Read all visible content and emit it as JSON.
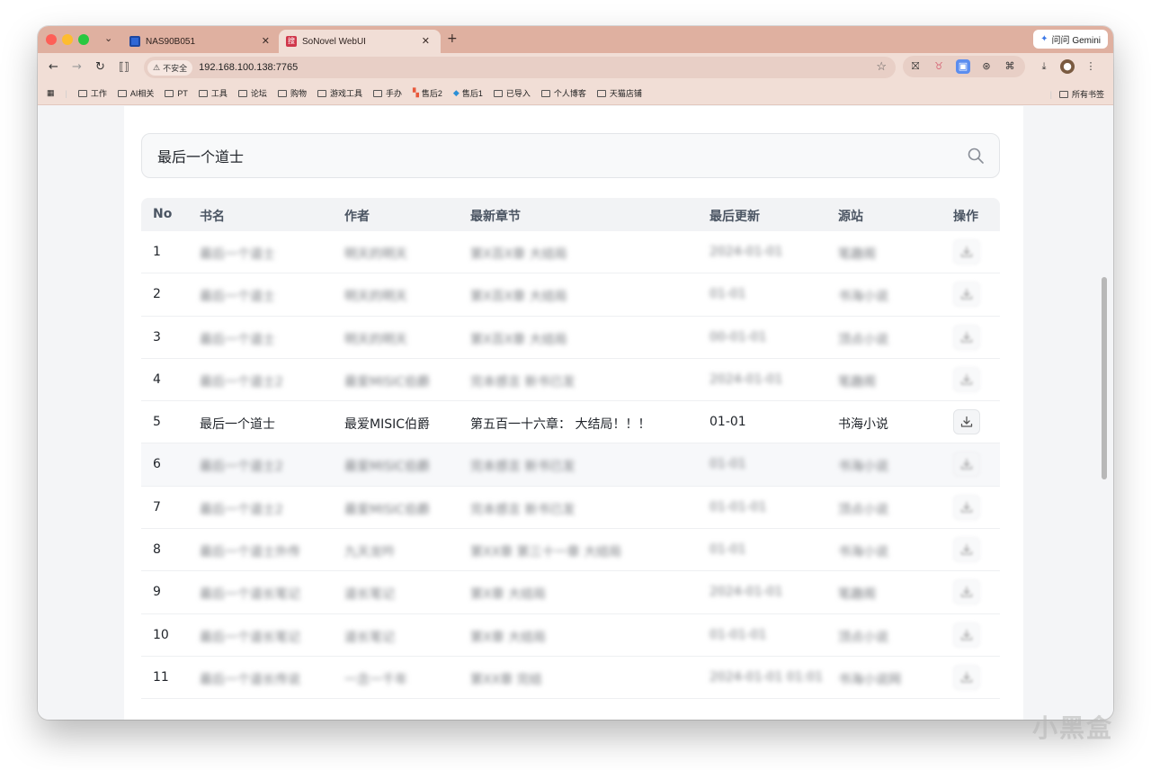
{
  "browser": {
    "tabs": [
      {
        "title": "NAS90B051"
      },
      {
        "title": "SoNovel WebUI"
      }
    ],
    "gemini_label": "问问 Gemini",
    "insecure_label": "不安全",
    "url": "192.168.100.138:7765",
    "bookmarks": [
      "工作",
      "AI相关",
      "PT",
      "工具",
      "论坛",
      "购物",
      "游戏工具",
      "手办",
      "售后2",
      "售后1",
      "已导入",
      "个人博客",
      "天猫店铺"
    ],
    "all_bookmarks": "所有书签",
    "colors": {
      "tabstrip": "#dfb0a0",
      "toolbar": "#f1ded6"
    }
  },
  "search": {
    "query": "最后一个道士"
  },
  "table": {
    "headers": [
      "No",
      "书名",
      "作者",
      "最新章节",
      "最后更新",
      "源站",
      "操作"
    ],
    "rows": [
      {
        "no": "1",
        "name": "最后一个道士",
        "author": "明天的明天",
        "chapter": "第X百X章 大结局",
        "update": "2024-01-01",
        "source": "笔趣阁",
        "visible": false
      },
      {
        "no": "2",
        "name": "最后一个道士",
        "author": "明天的明天",
        "chapter": "第X百X章 大结局",
        "update": "01-01",
        "source": "书海小说",
        "visible": false
      },
      {
        "no": "3",
        "name": "最后一个道士",
        "author": "明天的明天",
        "chapter": "第X百X章 大结局",
        "update": "00-01-01",
        "source": "顶点小说",
        "visible": false
      },
      {
        "no": "4",
        "name": "最后一个道士2",
        "author": "最爱MISIC伯爵",
        "chapter": "完本感言 新书已发",
        "update": "2024-01-01",
        "source": "笔趣阁",
        "visible": false
      },
      {
        "no": "5",
        "name": "最后一个道士",
        "author": "最爱MISIC伯爵",
        "chapter": "第五百一十六章： 大结局！！！",
        "update": "01-01",
        "source": "书海小说",
        "visible": true
      },
      {
        "no": "6",
        "name": "最后一个道士2",
        "author": "最爱MISIC伯爵",
        "chapter": "完本感言 新书已发",
        "update": "01-01",
        "source": "书海小说",
        "visible": false
      },
      {
        "no": "7",
        "name": "最后一个道士2",
        "author": "最爱MISIC伯爵",
        "chapter": "完本感言 新书已发",
        "update": "01-01-01",
        "source": "顶点小说",
        "visible": false
      },
      {
        "no": "8",
        "name": "最后一个道士外传",
        "author": "九天龙吟",
        "chapter": "第XX章 第三十一章 大结局",
        "update": "01-01",
        "source": "书海小说",
        "visible": false
      },
      {
        "no": "9",
        "name": "最后一个道长笔记",
        "author": "道长笔记",
        "chapter": "第X章 大结局",
        "update": "2024-01-01",
        "source": "笔趣阁",
        "visible": false
      },
      {
        "no": "10",
        "name": "最后一个道长笔记",
        "author": "道长笔记",
        "chapter": "第X章 大结局",
        "update": "01-01-01",
        "source": "顶点小说",
        "visible": false
      },
      {
        "no": "11",
        "name": "最后一个道长传说",
        "author": "一念一千年",
        "chapter": "第XX章 完结",
        "update": "2024-01-01 01:01",
        "source": "书海小说网",
        "visible": false
      }
    ]
  },
  "watermark": "小黑盒"
}
